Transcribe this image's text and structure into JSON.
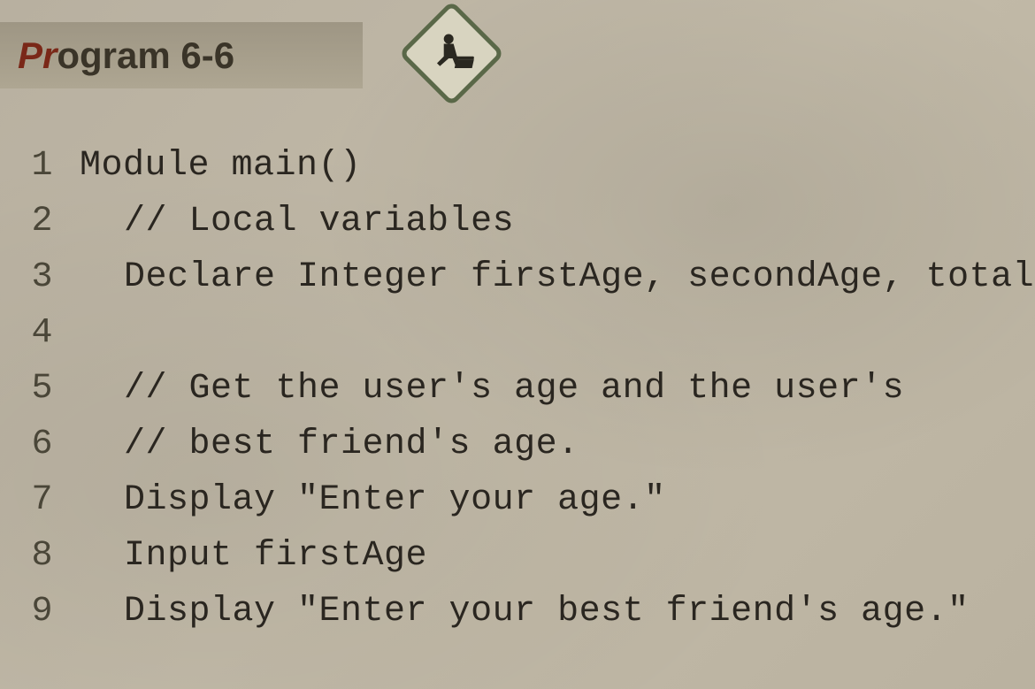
{
  "header": {
    "title_prefix": "Pr",
    "title_rest": "ogram 6-6"
  },
  "icon": {
    "name": "hands-on-keyboard-icon"
  },
  "code": {
    "lines": [
      {
        "num": "1",
        "indent": 0,
        "text": "Module main()"
      },
      {
        "num": "2",
        "indent": 1,
        "text": "// Local variables"
      },
      {
        "num": "3",
        "indent": 1,
        "text": "Declare Integer firstAge, secondAge, total"
      },
      {
        "num": "4",
        "indent": 1,
        "text": ""
      },
      {
        "num": "5",
        "indent": 1,
        "text": "// Get the user's age and the user's"
      },
      {
        "num": "6",
        "indent": 1,
        "text": "// best friend's age."
      },
      {
        "num": "7",
        "indent": 1,
        "text": "Display \"Enter your age.\""
      },
      {
        "num": "8",
        "indent": 1,
        "text": "Input firstAge"
      },
      {
        "num": "9",
        "indent": 1,
        "text": "Display \"Enter your best friend's age.\""
      }
    ]
  }
}
